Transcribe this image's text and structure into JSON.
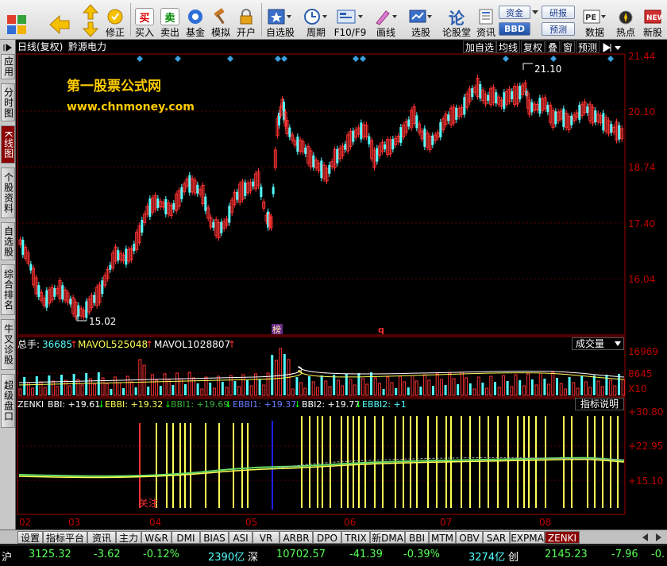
{
  "toolbar": {
    "items": [
      {
        "label": "",
        "icon": "windows-logo-icon"
      },
      {
        "label": "",
        "icon": "back-arrow-icon"
      },
      {
        "label": "修正",
        "icon": "revise-icon"
      },
      {
        "label": "买入",
        "icon": "buy-icon",
        "glyph": "买"
      },
      {
        "label": "卖出",
        "icon": "sell-icon",
        "glyph": "卖"
      },
      {
        "label": "基金",
        "icon": "fund-icon"
      },
      {
        "label": "模拟",
        "icon": "hammer-icon"
      },
      {
        "label": "开户",
        "icon": "lock-icon"
      },
      {
        "label": "自选股",
        "icon": "star-icon"
      },
      {
        "label": "周期",
        "icon": "clock-icon"
      },
      {
        "label": "F10/F9",
        "icon": "f10-icon"
      },
      {
        "label": "画线",
        "icon": "pen-icon"
      },
      {
        "label": "选股",
        "icon": "screen-icon"
      },
      {
        "label": "论股堂",
        "icon": "forum-icon",
        "glyph": "论"
      },
      {
        "label": "资讯",
        "icon": "news-icon"
      },
      {
        "label": "数据",
        "icon": "pe-icon"
      },
      {
        "label": "热点",
        "icon": "hot-icon"
      },
      {
        "label": "新股",
        "icon": "new-stock-icon"
      }
    ],
    "pills": [
      "资金",
      "BBD",
      "研报",
      "预测"
    ]
  },
  "left_tabs": [
    "应用",
    "分时图",
    "K线图",
    "个股资料",
    "自选股",
    "综合排名",
    "牛叉诊股",
    "超级盘口"
  ],
  "header": {
    "period": "日线(复权)",
    "stock_name": "黔源电力",
    "buttons": [
      "加自选",
      "均线",
      "复权",
      "叠",
      "窗",
      "预测"
    ]
  },
  "watermark": {
    "line1": "第一股票公式网",
    "line2": "www.chnmoney.com"
  },
  "price_axis": [
    "21.44",
    "20.10",
    "18.74",
    "17.40",
    "16.04"
  ],
  "annotations": {
    "high": "21.10",
    "low": "15.02",
    "marker1": "榜",
    "marker2": "q"
  },
  "volume": {
    "label_total": "总手:",
    "total": "36685",
    "label_ma5": "MAVOL5:",
    "ma5": "25048",
    "label_ma10": "MAVOL10:",
    "ma10": "28807",
    "select": "成交量",
    "axis": [
      "16969",
      "8645",
      "X10"
    ]
  },
  "indicator": {
    "name": "ZENKI",
    "bbi": "BBI: +19.61",
    "ebbi": "EBBI: +19.32",
    "bbi1": "BBI1: +19.69",
    "ebbi1": "EBBI1: +19.37",
    "bbi2": "BBI2: +19.77",
    "ebbi2": "EBBI2: +1",
    "explain": "指标说明",
    "axis": [
      "+30.80",
      "+22.95",
      "+15.10"
    ],
    "note": "关注"
  },
  "x_axis": [
    "02",
    "03",
    "04",
    "05",
    "06",
    "07",
    "08"
  ],
  "bottom_tabs": [
    "设置",
    "指标平台",
    "资讯",
    "主力",
    "W&R",
    "DMI",
    "BIAS",
    "ASI",
    "VR",
    "ARBR",
    "DPO",
    "TRIX",
    "新DMA",
    "BBI",
    "MTM",
    "OBV",
    "SAR",
    "EXPMA",
    "ZENKI"
  ],
  "status": {
    "sh_label": "沪",
    "sh_index": "3125.32",
    "sh_change": "-3.62",
    "sh_pct": "-0.12%",
    "sh_amount": "2390亿",
    "sz_label": "深",
    "sz_index": "10702.57",
    "sz_change": "-41.39",
    "sz_pct": "-0.39%",
    "sz_amount": "3274亿",
    "cy_label": "创",
    "cy_index": "2145.23",
    "cy_change": "-7.96",
    "cy_pct": "-0."
  },
  "colors": {
    "up": "#ff3232",
    "down": "#54ffff",
    "axis_red": "#c00000",
    "label_yellow": "#ffcc00"
  }
}
